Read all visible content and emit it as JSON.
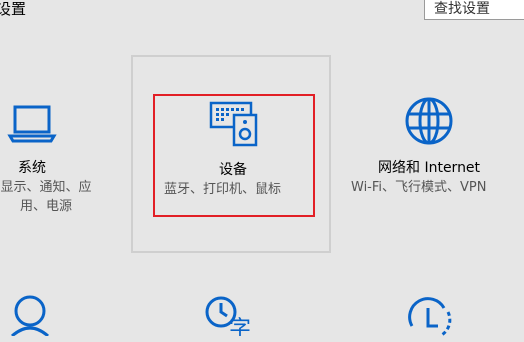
{
  "window": {
    "title": "设置"
  },
  "search": {
    "placeholder": "查找设置"
  },
  "tiles": [
    {
      "name": "系统",
      "desc": "显示、通知、应用、电源",
      "icon": "laptop-icon"
    },
    {
      "name": "设备",
      "desc": "蓝牙、打印机、鼠标",
      "icon": "devices-icon"
    },
    {
      "name": "网络和 Internet",
      "desc": "Wi-Fi、飞行模式、VPN",
      "icon": "globe-icon"
    }
  ],
  "bottom_icons": [
    "person-icon",
    "time-language-icon",
    "ease-of-access-icon"
  ],
  "colors": {
    "accent": "#0a64c8",
    "highlight": "#e21f26",
    "background": "#e6e6e6"
  }
}
